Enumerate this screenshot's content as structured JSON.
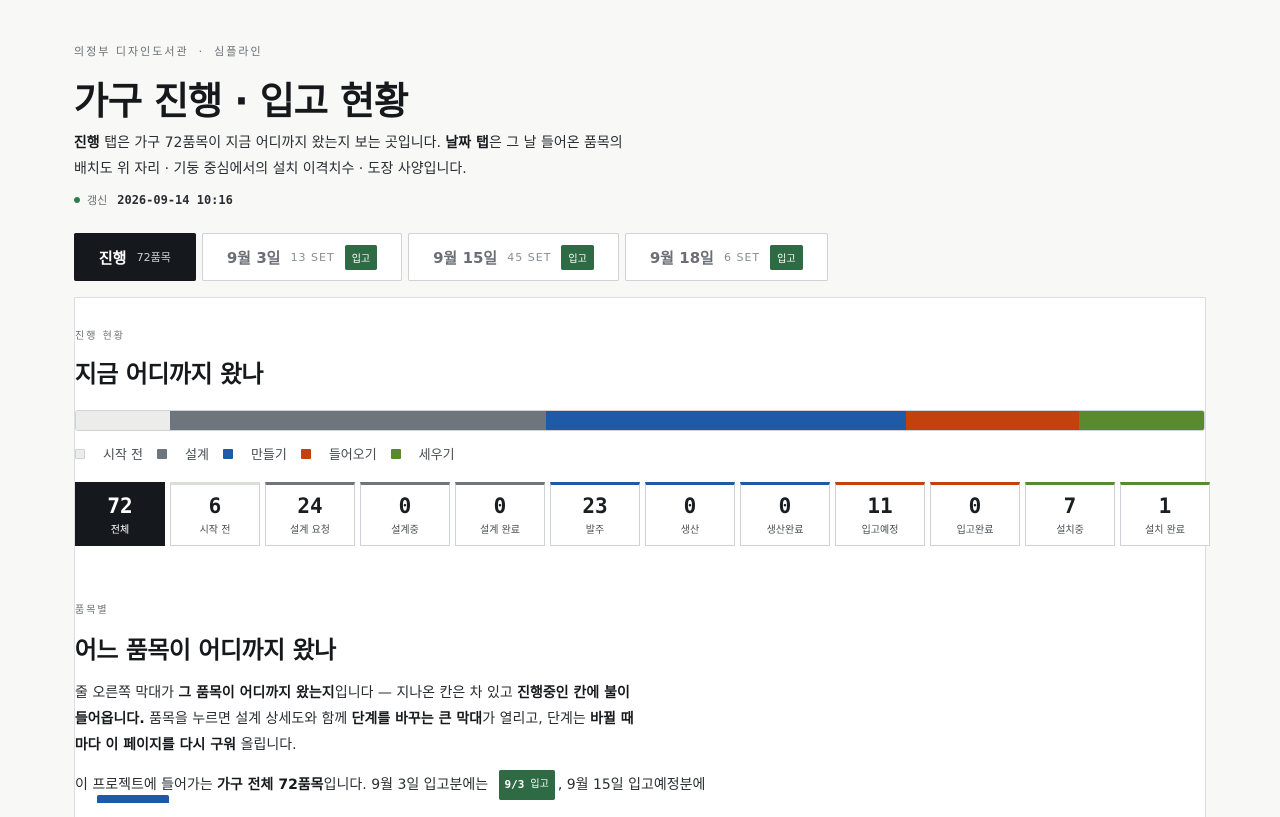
{
  "header": {
    "crumb_org": "의정부 디자인도서관",
    "crumb_sep": "·",
    "crumb_sub": "심플라인",
    "title": "가구 진행 · 입고 현황",
    "intro": {
      "b1": "진행",
      "t1": " 탭은 가구 72품목이 지금 어디까지 왔는지 보는 곳입니다. ",
      "b2": "날짜 탭",
      "t2": "은 그 날 들어온 품목의 배치도 위 자리 · 기둥 중심에서의 설치 이격치수 · 도장 사양입니다."
    },
    "updated_label": "갱신",
    "updated_value": "2026-09-14 10:16"
  },
  "tabs": [
    {
      "name": "진행",
      "count": "72품목",
      "active": true
    },
    {
      "name": "9월 3일",
      "count": "13 SET",
      "badge": "입고"
    },
    {
      "name": "9월 15일",
      "count": "45 SET",
      "badge": "입고"
    },
    {
      "name": "9월 18일",
      "count": "6 SET",
      "badge": "입고"
    }
  ],
  "progress": {
    "eyebrow": "진행 현황",
    "title": "지금 어디까지 왔나",
    "legend": [
      {
        "label": "시작 전",
        "color": "#ececea"
      },
      {
        "label": "설계",
        "color": "#6f757c"
      },
      {
        "label": "만들기",
        "color": "#1f5aa6"
      },
      {
        "label": "들어오기",
        "color": "#c2410c"
      },
      {
        "label": "세우기",
        "color": "#5a8a2e"
      }
    ],
    "bar": [
      {
        "stage": "시작 전",
        "count": 6,
        "color": "#ececea"
      },
      {
        "stage": "설계",
        "count": 24,
        "color": "#6f757c"
      },
      {
        "stage": "만들기",
        "count": 23,
        "color": "#1f5aa6"
      },
      {
        "stage": "들어오기",
        "count": 11,
        "color": "#c2410c"
      },
      {
        "stage": "세우기",
        "count": 8,
        "color": "#5a8a2e"
      }
    ],
    "stats": [
      {
        "num": "72",
        "label": "전체",
        "total": true
      },
      {
        "num": "6",
        "label": "시작 전",
        "color": "#dcdedc"
      },
      {
        "num": "24",
        "label": "설계 요청",
        "color": "#6f757c"
      },
      {
        "num": "0",
        "label": "설계중",
        "color": "#6f757c"
      },
      {
        "num": "0",
        "label": "설계 완료",
        "color": "#6f757c"
      },
      {
        "num": "23",
        "label": "발주",
        "color": "#1f5aa6"
      },
      {
        "num": "0",
        "label": "생산",
        "color": "#1f5aa6"
      },
      {
        "num": "0",
        "label": "생산완료",
        "color": "#1f5aa6"
      },
      {
        "num": "11",
        "label": "입고예정",
        "color": "#c2410c"
      },
      {
        "num": "0",
        "label": "입고완료",
        "color": "#c2410c"
      },
      {
        "num": "7",
        "label": "설치중",
        "color": "#5a8a2e"
      },
      {
        "num": "1",
        "label": "설치 완료",
        "color": "#5a8a2e"
      }
    ]
  },
  "items": {
    "eyebrow": "품목별",
    "title": "어느 품목이 어디까지 왔나",
    "desc": {
      "t1": "줄 오른쪽 막대가 ",
      "b1": "그 품목이 어디까지 왔는지",
      "t2": "입니다 — 지나온 칸은 차 있고 ",
      "b2": "진행중인 칸에 불이 들어옵니다.",
      "t3": " 품목을 누르면 설계 상세도와 함께 ",
      "b3": "단계를 바꾸는 큰 막대",
      "t4": "가 열리고, 단계는 ",
      "b4": "바뀔 때마다 이 페이지를 다시 구워",
      "t5": " 올립니다."
    },
    "desc2": {
      "t1": "이 프로젝트에 들어가는 ",
      "b1": "가구 전체 72품목",
      "t2": "입니다. 9월 3일 입고분에는 ",
      "pill_date": "9/3",
      "pill_label": "입고",
      "t3": ", 9월 15일 입고예정분에"
    }
  }
}
